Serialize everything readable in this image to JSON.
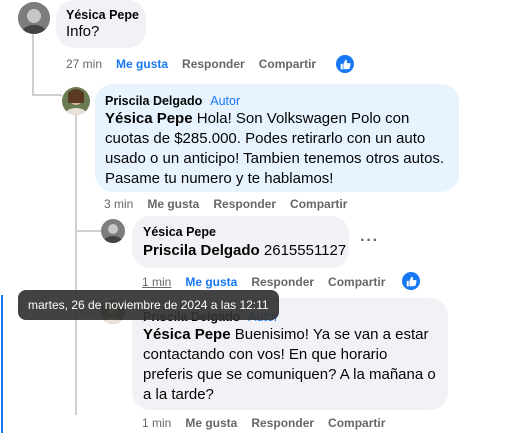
{
  "comments": [
    {
      "author": "Yésica Pepe",
      "text": "Info?",
      "time": "27 min",
      "actions": {
        "like": "Me gusta",
        "reply": "Responder",
        "share": "Compartir"
      }
    },
    {
      "author": "Priscila Delgado",
      "badge": "Autor",
      "mention": "Yésica Pepe",
      "text": " Hola! Son Volkswagen Polo con cuotas de $285.000. Podes retirarlo con un auto usado o un anticipo! Tambien tenemos otros autos. Pasame tu numero y te hablamos!",
      "time": "3 min",
      "actions": {
        "like": "Me gusta",
        "reply": "Responder",
        "share": "Compartir"
      }
    },
    {
      "author": "Yésica Pepe",
      "mention": "Priscila Delgado",
      "text": " 2615551127",
      "time": "1 min",
      "actions": {
        "like": "Me gusta",
        "reply": "Responder",
        "share": "Compartir"
      }
    },
    {
      "author": "Priscila Delgado",
      "badge": "Autor",
      "mention": "Yésica Pepe",
      "text": " Buenisimo! Ya se van a estar contactando con vos! En que horario preferis que se comuniquen? A la mañana o a la tarde?",
      "time": "1 min",
      "actions": {
        "like": "Me gusta",
        "reply": "Responder",
        "share": "Compartir"
      }
    }
  ],
  "tooltip": "martes, 26 de noviembre de 2024 a las 12:11",
  "more_dots": "···",
  "colors": {
    "accent": "#1877f2",
    "bubble": "#f0f2f5",
    "bubble_highlight": "#e7f3ff",
    "meta": "#65676b"
  },
  "icons": {
    "like": "thumbs-up-icon",
    "more": "more-options-icon"
  }
}
